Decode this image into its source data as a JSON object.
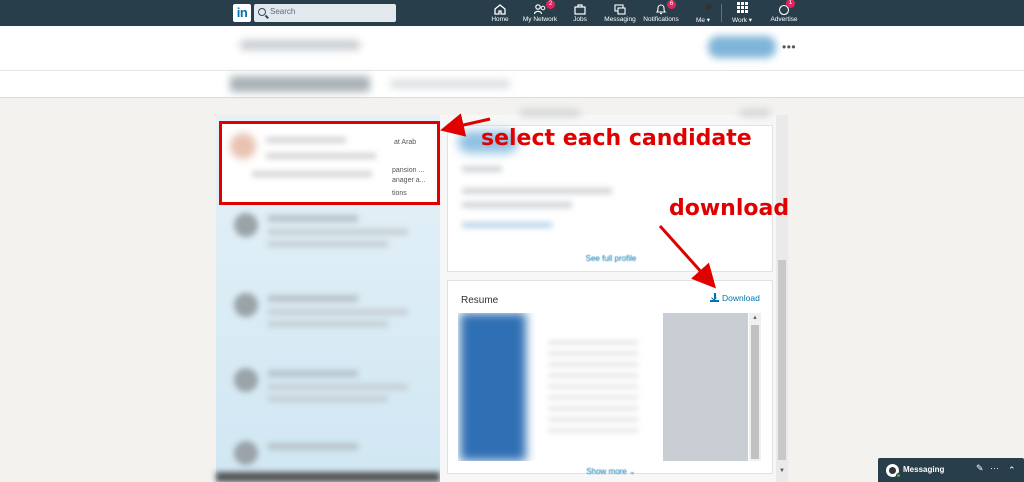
{
  "nav": {
    "logo_text": "in",
    "search_placeholder": "Search",
    "items": [
      {
        "label": "Home",
        "icon": "home-icon",
        "badge": ""
      },
      {
        "label": "My Network",
        "icon": "network-icon",
        "badge": "2"
      },
      {
        "label": "Jobs",
        "icon": "jobs-icon",
        "badge": ""
      },
      {
        "label": "Messaging",
        "icon": "messaging-icon",
        "badge": ""
      },
      {
        "label": "Notifications",
        "icon": "bell-icon",
        "badge": "6"
      },
      {
        "label": "Me ▾",
        "icon": "avatar",
        "badge": ""
      },
      {
        "label": "Work ▾",
        "icon": "grid-icon",
        "badge": ""
      },
      {
        "label": "Advertise",
        "icon": "advertise-icon",
        "badge": "1"
      }
    ]
  },
  "subbar": {
    "more_label": "•••"
  },
  "candidate_card": {
    "snippets": [
      "at Arab",
      "pansion ...",
      "anager a...",
      "tions"
    ]
  },
  "profile": {
    "see_full_label": "See full profile"
  },
  "resume": {
    "title": "Resume",
    "download_label": "Download",
    "show_more_label": "Show more ⌄"
  },
  "annotations": {
    "select_label": "select each candidate",
    "download_label": "download",
    "color": "#e00000"
  },
  "messaging": {
    "label": "Messaging",
    "compose_icon": "✎",
    "more_icon": "···",
    "collapse_icon": "⌃"
  },
  "colors": {
    "nav_bg": "#283e4a",
    "link": "#0073b1",
    "badge": "#e0245e"
  }
}
